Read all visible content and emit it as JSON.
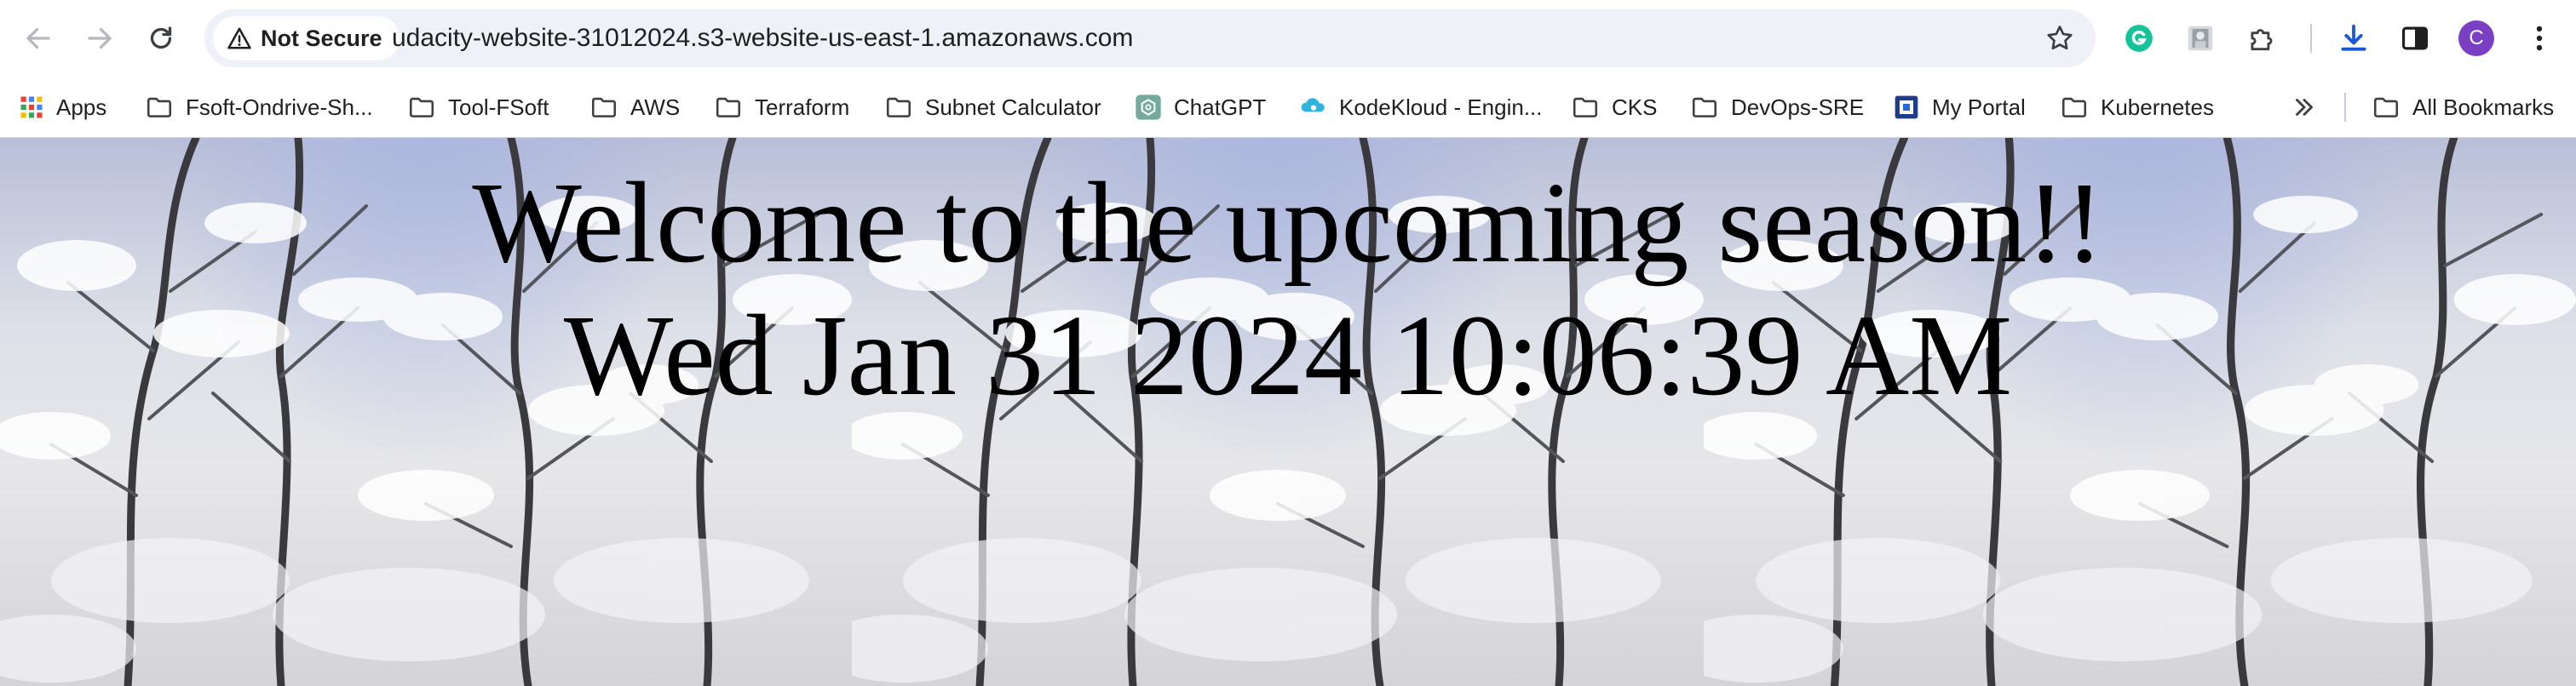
{
  "browser": {
    "security_label": "Not Secure",
    "url": "udacity-website-31012024.s3-website-us-east-1.amazonaws.com",
    "profile_initial": "C",
    "icons": {
      "back": "back-arrow-icon",
      "forward": "forward-arrow-icon",
      "reload": "reload-icon",
      "warning": "warning-triangle-icon",
      "star": "star-icon",
      "grammarly": "grammarly-icon",
      "extension_profile": "extension-image-icon",
      "extensions": "puzzle-icon",
      "downloads": "download-icon",
      "side_panel": "side-panel-icon",
      "menu": "kebab-menu-icon"
    },
    "colors": {
      "omnibox_bg": "#eef1f8",
      "grammarly": "#15c39a",
      "download": "#1a56d6",
      "avatar": "#7b3fc4"
    }
  },
  "bookmarks": {
    "items": [
      {
        "label": "Apps",
        "icon": "apps-grid-icon"
      },
      {
        "label": "Fsoft-Ondrive-Sh...",
        "icon": "folder-icon"
      },
      {
        "label": "Tool-FSoft",
        "icon": "folder-icon"
      },
      {
        "label": "AWS",
        "icon": "folder-icon"
      },
      {
        "label": "Terraform",
        "icon": "folder-icon"
      },
      {
        "label": "Subnet Calculator",
        "icon": "folder-icon"
      },
      {
        "label": "ChatGPT",
        "icon": "chatgpt-icon"
      },
      {
        "label": "KodeKloud - Engin...",
        "icon": "kodekloud-icon"
      },
      {
        "label": "CKS",
        "icon": "folder-icon"
      },
      {
        "label": "DevOps-SRE",
        "icon": "folder-icon"
      },
      {
        "label": "My Portal",
        "icon": "portal-icon"
      },
      {
        "label": "Kubernetes",
        "icon": "folder-icon"
      }
    ],
    "overflow_icon": "chevron-double-right-icon",
    "all_bookmarks": {
      "label": "All Bookmarks",
      "icon": "folder-icon"
    }
  },
  "page": {
    "headline": "Welcome to the upcoming season!!",
    "datetime": "Wed Jan 31 2024 10:06:39 AM",
    "background": "snowy-forest-image"
  }
}
